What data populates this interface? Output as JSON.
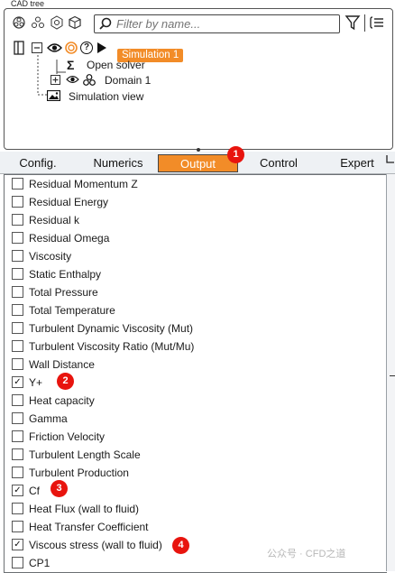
{
  "panel_title": "CAD tree",
  "filter": {
    "placeholder": "Filter by name..."
  },
  "tree": {
    "simulation_label": "Simulation 1",
    "help_glyph": "?",
    "open_solver_label": "Open solver",
    "domain_label": "Domain 1",
    "simulation_view_label": "Simulation view"
  },
  "tabs": [
    {
      "label": "Config."
    },
    {
      "label": "Numerics"
    },
    {
      "label": "Output",
      "active": true
    },
    {
      "label": "Control"
    },
    {
      "label": "Expert"
    }
  ],
  "output_items": [
    {
      "label": "Residual Momentum Z",
      "checked": false
    },
    {
      "label": "Residual Energy",
      "checked": false
    },
    {
      "label": "Residual k",
      "checked": false
    },
    {
      "label": "Residual Omega",
      "checked": false
    },
    {
      "label": "Viscosity",
      "checked": false
    },
    {
      "label": "Static Enthalpy",
      "checked": false
    },
    {
      "label": "Total Pressure",
      "checked": false
    },
    {
      "label": "Total Temperature",
      "checked": false
    },
    {
      "label": "Turbulent Dynamic Viscosity (Mut)",
      "checked": false
    },
    {
      "label": "Turbulent Viscosity Ratio (Mut/Mu)",
      "checked": false
    },
    {
      "label": "Wall Distance",
      "checked": false
    },
    {
      "label": "Y+",
      "checked": true
    },
    {
      "label": "Heat capacity",
      "checked": false
    },
    {
      "label": "Gamma",
      "checked": false
    },
    {
      "label": "Friction Velocity",
      "checked": false
    },
    {
      "label": "Turbulent Length Scale",
      "checked": false
    },
    {
      "label": "Turbulent Production",
      "checked": false
    },
    {
      "label": "Cf",
      "checked": true
    },
    {
      "label": "Heat Flux (wall to fluid)",
      "checked": false
    },
    {
      "label": "Heat Transfer Coefficient",
      "checked": false
    },
    {
      "label": "Viscous stress (wall to fluid)",
      "checked": true
    },
    {
      "label": "CP1",
      "checked": false
    }
  ],
  "annotations": [
    "1",
    "2",
    "3",
    "4"
  ],
  "check_glyph": "✓",
  "watermark": "公众号 · CFD之道",
  "colors": {
    "accent": "#f28c28",
    "annotation": "#e8140e"
  },
  "icons": [
    "assembly-icon",
    "parts-icon",
    "components-icon",
    "cube-icon",
    "search-icon",
    "filter-icon",
    "list-settings-icon",
    "eye-icon",
    "target-icon",
    "help-icon",
    "play-icon",
    "sigma-icon",
    "image-icon",
    "collapse-icon",
    "expand-icon"
  ]
}
